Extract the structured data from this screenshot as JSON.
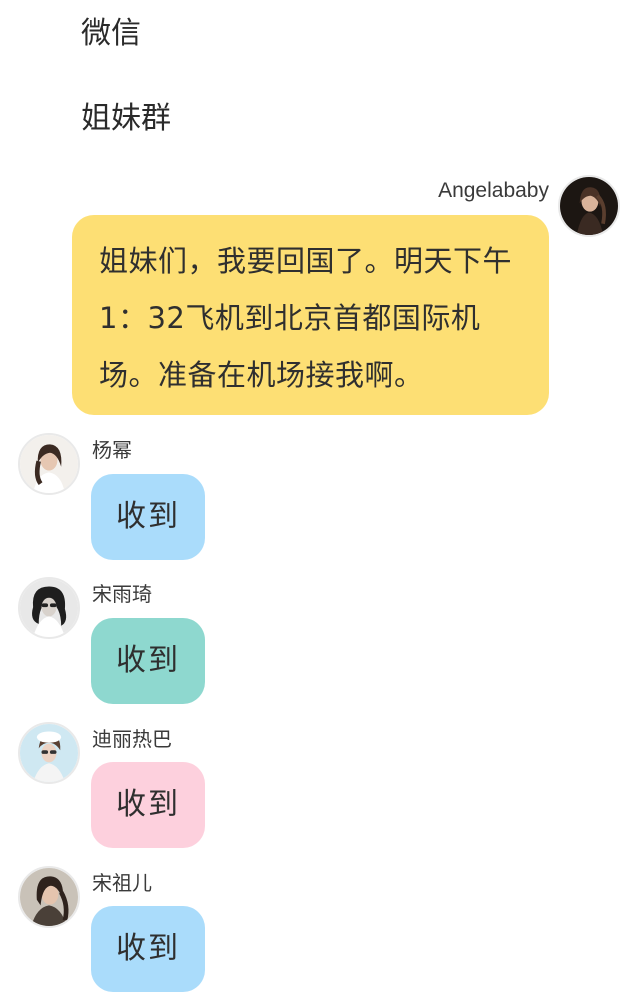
{
  "header": {
    "app_title": "微信",
    "group_title": "姐妹群"
  },
  "messages": [
    {
      "sender": "Angelababy",
      "side": "right",
      "avatar_icon": "avatar-angelababy",
      "bubble_color": "#fddf74",
      "text": "姐妹们，我要回国了。明天下午1：32飞机到北京首都国际机场。准备在机场接我啊。"
    },
    {
      "sender": "杨幂",
      "side": "left",
      "avatar_icon": "avatar-yangmi",
      "bubble_color": "#aadcfb",
      "text": "收到"
    },
    {
      "sender": "宋雨琦",
      "side": "left",
      "avatar_icon": "avatar-songyuqi",
      "bubble_color": "#8ed8cf",
      "text": "收到"
    },
    {
      "sender": "迪丽热巴",
      "side": "left",
      "avatar_icon": "avatar-dilireba",
      "bubble_color": "#fdd0dd",
      "text": "收到"
    },
    {
      "sender": "宋祖儿",
      "side": "left",
      "avatar_icon": "avatar-songzuer",
      "bubble_color": "#aadcfb",
      "text": "收到"
    }
  ]
}
